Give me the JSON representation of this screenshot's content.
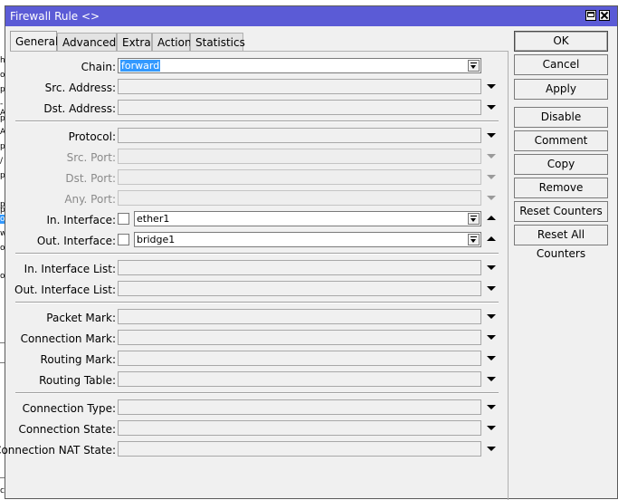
{
  "window": {
    "title": "Firewall Rule <>"
  },
  "tabs": [
    {
      "label": "General"
    },
    {
      "label": "Advanced"
    },
    {
      "label": "Extra"
    },
    {
      "label": "Action"
    },
    {
      "label": "Statistics"
    }
  ],
  "active_tab": "General",
  "fields": {
    "chain": {
      "label": "Chain:",
      "value": "forward"
    },
    "src_address": {
      "label": "Src. Address:",
      "value": ""
    },
    "dst_address": {
      "label": "Dst. Address:",
      "value": ""
    },
    "protocol": {
      "label": "Protocol:",
      "value": ""
    },
    "src_port": {
      "label": "Src. Port:",
      "value": ""
    },
    "dst_port": {
      "label": "Dst. Port:",
      "value": ""
    },
    "any_port": {
      "label": "Any. Port:",
      "value": ""
    },
    "in_interface": {
      "label": "In. Interface:",
      "value": "ether1",
      "negate": false
    },
    "out_interface": {
      "label": "Out. Interface:",
      "value": "bridge1",
      "negate": false
    },
    "in_interface_list": {
      "label": "In. Interface List:",
      "value": ""
    },
    "out_interface_list": {
      "label": "Out. Interface List:",
      "value": ""
    },
    "packet_mark": {
      "label": "Packet Mark:",
      "value": ""
    },
    "connection_mark": {
      "label": "Connection Mark:",
      "value": ""
    },
    "routing_mark": {
      "label": "Routing Mark:",
      "value": ""
    },
    "routing_table": {
      "label": "Routing Table:",
      "value": ""
    },
    "connection_type": {
      "label": "Connection Type:",
      "value": ""
    },
    "connection_state": {
      "label": "Connection State:",
      "value": ""
    },
    "connection_nat_state": {
      "label": "Connection NAT State:",
      "value": ""
    }
  },
  "buttons": {
    "ok": "OK",
    "cancel": "Cancel",
    "apply": "Apply",
    "disable": "Disable",
    "comment": "Comment",
    "copy": "Copy",
    "remove": "Remove",
    "reset_counters": "Reset Counters",
    "reset_all_counters": "Reset All Counters"
  },
  "icons": {
    "maximize": "maximize-icon",
    "close": "close-icon",
    "dropdown": "dropdown-arrow-icon",
    "combo": "combo-dropdown-icon",
    "collapse": "collapse-arrow-icon"
  },
  "colors": {
    "titlebar": "#5b5bd6",
    "selection": "#3399ff",
    "window_bg": "#f0f0f0"
  },
  "background_window": {
    "glyphs": [
      "h",
      "o",
      "p",
      "-A",
      "p",
      "A",
      "p",
      "/",
      "p",
      "p",
      "p",
      "or",
      "w",
      "or",
      "or",
      "ct"
    ]
  }
}
